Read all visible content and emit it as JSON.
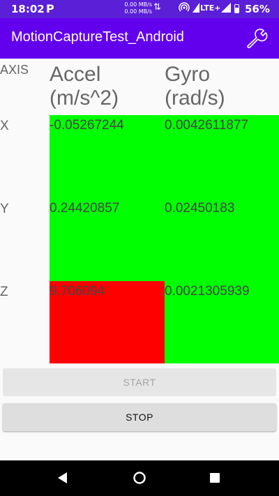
{
  "status_bar": {
    "time": "18:02",
    "app_indicator": "P",
    "net_up": "0.00 MB/s",
    "net_down": "0.00 MB/s",
    "network_type": "LTE+",
    "battery": "56%"
  },
  "app_bar": {
    "title": "MotionCaptureTest_Android",
    "settings_icon": "wrench-icon"
  },
  "table": {
    "axis_header": "AXIS",
    "accel_header": "Accel\n(m/s^2)",
    "gyro_header": "Gyro\n(rad/s)",
    "rows": [
      {
        "axis": "X",
        "accel": "-0.05267244",
        "gyro": "0.0042611877",
        "accel_color": "#00ff00",
        "gyro_color": "#00ff00"
      },
      {
        "axis": "Y",
        "accel": "0.24420857",
        "gyro": "0.02450183",
        "accel_color": "#00ff00",
        "gyro_color": "#00ff00"
      },
      {
        "axis": "Z",
        "accel": "9.706094",
        "gyro": "0.0021305939",
        "accel_color": "#ff0000",
        "gyro_color": "#00ff00"
      }
    ]
  },
  "buttons": {
    "start_label": "START",
    "stop_label": "STOP"
  },
  "colors": {
    "primary": "#6200ee",
    "status_bar": "#5a1fd6",
    "ok": "#00ff00",
    "alert": "#ff0000"
  }
}
